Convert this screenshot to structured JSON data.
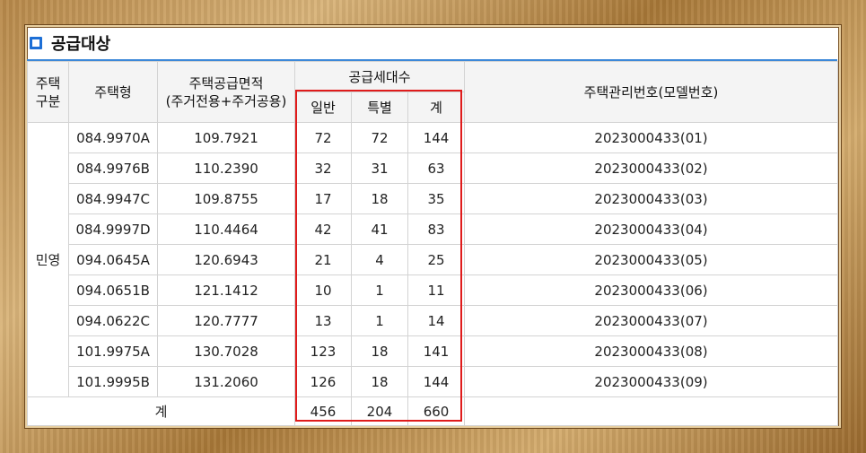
{
  "heading": {
    "icon": "checkbox-square-icon",
    "title": "공급대상"
  },
  "table": {
    "header": {
      "col_gubun": "주택\n구분",
      "col_type": "주택형",
      "col_area_line1": "주택공급면적",
      "col_area_line2": "(주거전용+주거공용)",
      "col_units": "공급세대수",
      "col_units_general": "일반",
      "col_units_special": "특별",
      "col_units_total": "계",
      "col_mgmt_no": "주택관리번호(모델번호)"
    },
    "group_label": "민영",
    "rows": [
      {
        "type": "084.9970A",
        "area": "109.7921",
        "general": "72",
        "special": "72",
        "total": "144",
        "mgmt": "2023000433(01)"
      },
      {
        "type": "084.9976B",
        "area": "110.2390",
        "general": "32",
        "special": "31",
        "total": "63",
        "mgmt": "2023000433(02)"
      },
      {
        "type": "084.9947C",
        "area": "109.8755",
        "general": "17",
        "special": "18",
        "total": "35",
        "mgmt": "2023000433(03)"
      },
      {
        "type": "084.9997D",
        "area": "110.4464",
        "general": "42",
        "special": "41",
        "total": "83",
        "mgmt": "2023000433(04)"
      },
      {
        "type": "094.0645A",
        "area": "120.6943",
        "general": "21",
        "special": "4",
        "total": "25",
        "mgmt": "2023000433(05)"
      },
      {
        "type": "094.0651B",
        "area": "121.1412",
        "general": "10",
        "special": "1",
        "total": "11",
        "mgmt": "2023000433(06)"
      },
      {
        "type": "094.0622C",
        "area": "120.7777",
        "general": "13",
        "special": "1",
        "total": "14",
        "mgmt": "2023000433(07)"
      },
      {
        "type": "101.9975A",
        "area": "130.7028",
        "general": "123",
        "special": "18",
        "total": "141",
        "mgmt": "2023000433(08)"
      },
      {
        "type": "101.9995B",
        "area": "131.2060",
        "general": "126",
        "special": "18",
        "total": "144",
        "mgmt": "2023000433(09)"
      }
    ],
    "totals": {
      "label": "계",
      "general": "456",
      "special": "204",
      "total": "660"
    }
  },
  "colors": {
    "accent": "#1d6fd6",
    "rule": "#3c88d8",
    "highlight": "#e01b1b",
    "frame": "#b8894a"
  }
}
